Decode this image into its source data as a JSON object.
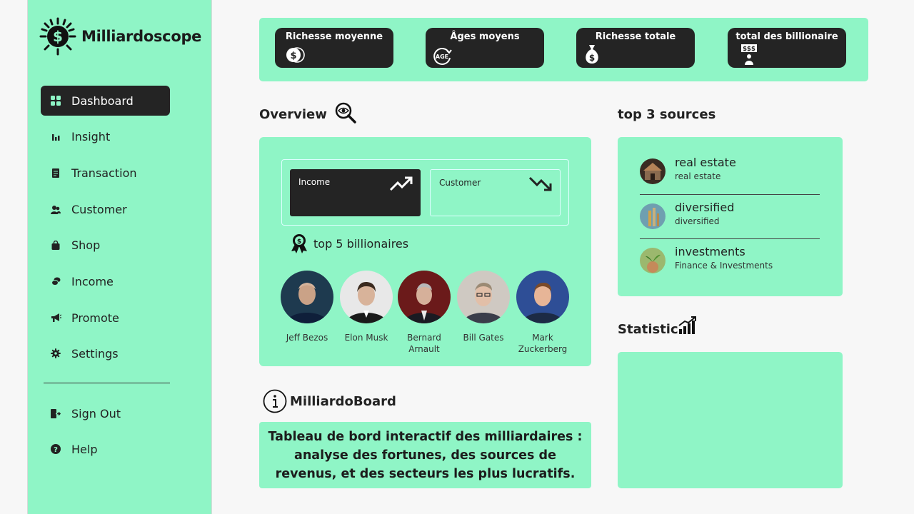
{
  "brand": {
    "name": "Milliardoscope",
    "logo_icon": "dollar-sun-icon"
  },
  "sidebar": {
    "items": [
      {
        "label": "Dashboard",
        "icon": "grid-icon",
        "active": true
      },
      {
        "label": "Insight",
        "icon": "bar-chart-icon"
      },
      {
        "label": "Transaction",
        "icon": "receipt-icon"
      },
      {
        "label": "Customer",
        "icon": "users-icon"
      },
      {
        "label": "Shop",
        "icon": "shopping-bag-icon"
      },
      {
        "label": "Income",
        "icon": "coins-icon"
      },
      {
        "label": "Promote",
        "icon": "megaphone-icon"
      },
      {
        "label": "Settings",
        "icon": "gear-icon"
      }
    ],
    "bottom_items": [
      {
        "label": "Sign Out",
        "icon": "sign-out-icon"
      },
      {
        "label": "Help",
        "icon": "help-icon"
      }
    ]
  },
  "stats": [
    {
      "title": "Richesse moyenne",
      "icon": "coin-stack-icon"
    },
    {
      "title": "Âges moyens",
      "icon": "age-icon"
    },
    {
      "title": "Richesse totale",
      "icon": "money-bag-icon"
    },
    {
      "title": "total des billionaire",
      "icon": "billionaire-icon"
    }
  ],
  "overview": {
    "title": "Overview",
    "income_label": "Income",
    "customer_label": "Customer",
    "top5_title": "top 5 billionaires",
    "people": [
      {
        "name": "Jeff Bezos"
      },
      {
        "name": "Elon Musk"
      },
      {
        "name": "Bernard Arnault"
      },
      {
        "name": "Bill Gates"
      },
      {
        "name": "Mark Zuckerberg"
      }
    ]
  },
  "info": {
    "title": "MilliardoBoard",
    "description": "Tableau de bord interactif des milliardaires : analyse des fortunes, des sources de revenus, et des secteurs les plus lucratifs."
  },
  "sources": {
    "title": "top 3 sources",
    "items": [
      {
        "title": "real estate",
        "subtitle": "real estate"
      },
      {
        "title": "diversified",
        "subtitle": "diversified"
      },
      {
        "title": "investments",
        "subtitle": "Finance & Investments"
      }
    ]
  },
  "statistic": {
    "title": "Statistic"
  },
  "colors": {
    "accent": "#8ff5c6",
    "dark": "#242424",
    "background": "#f7f7f7"
  }
}
